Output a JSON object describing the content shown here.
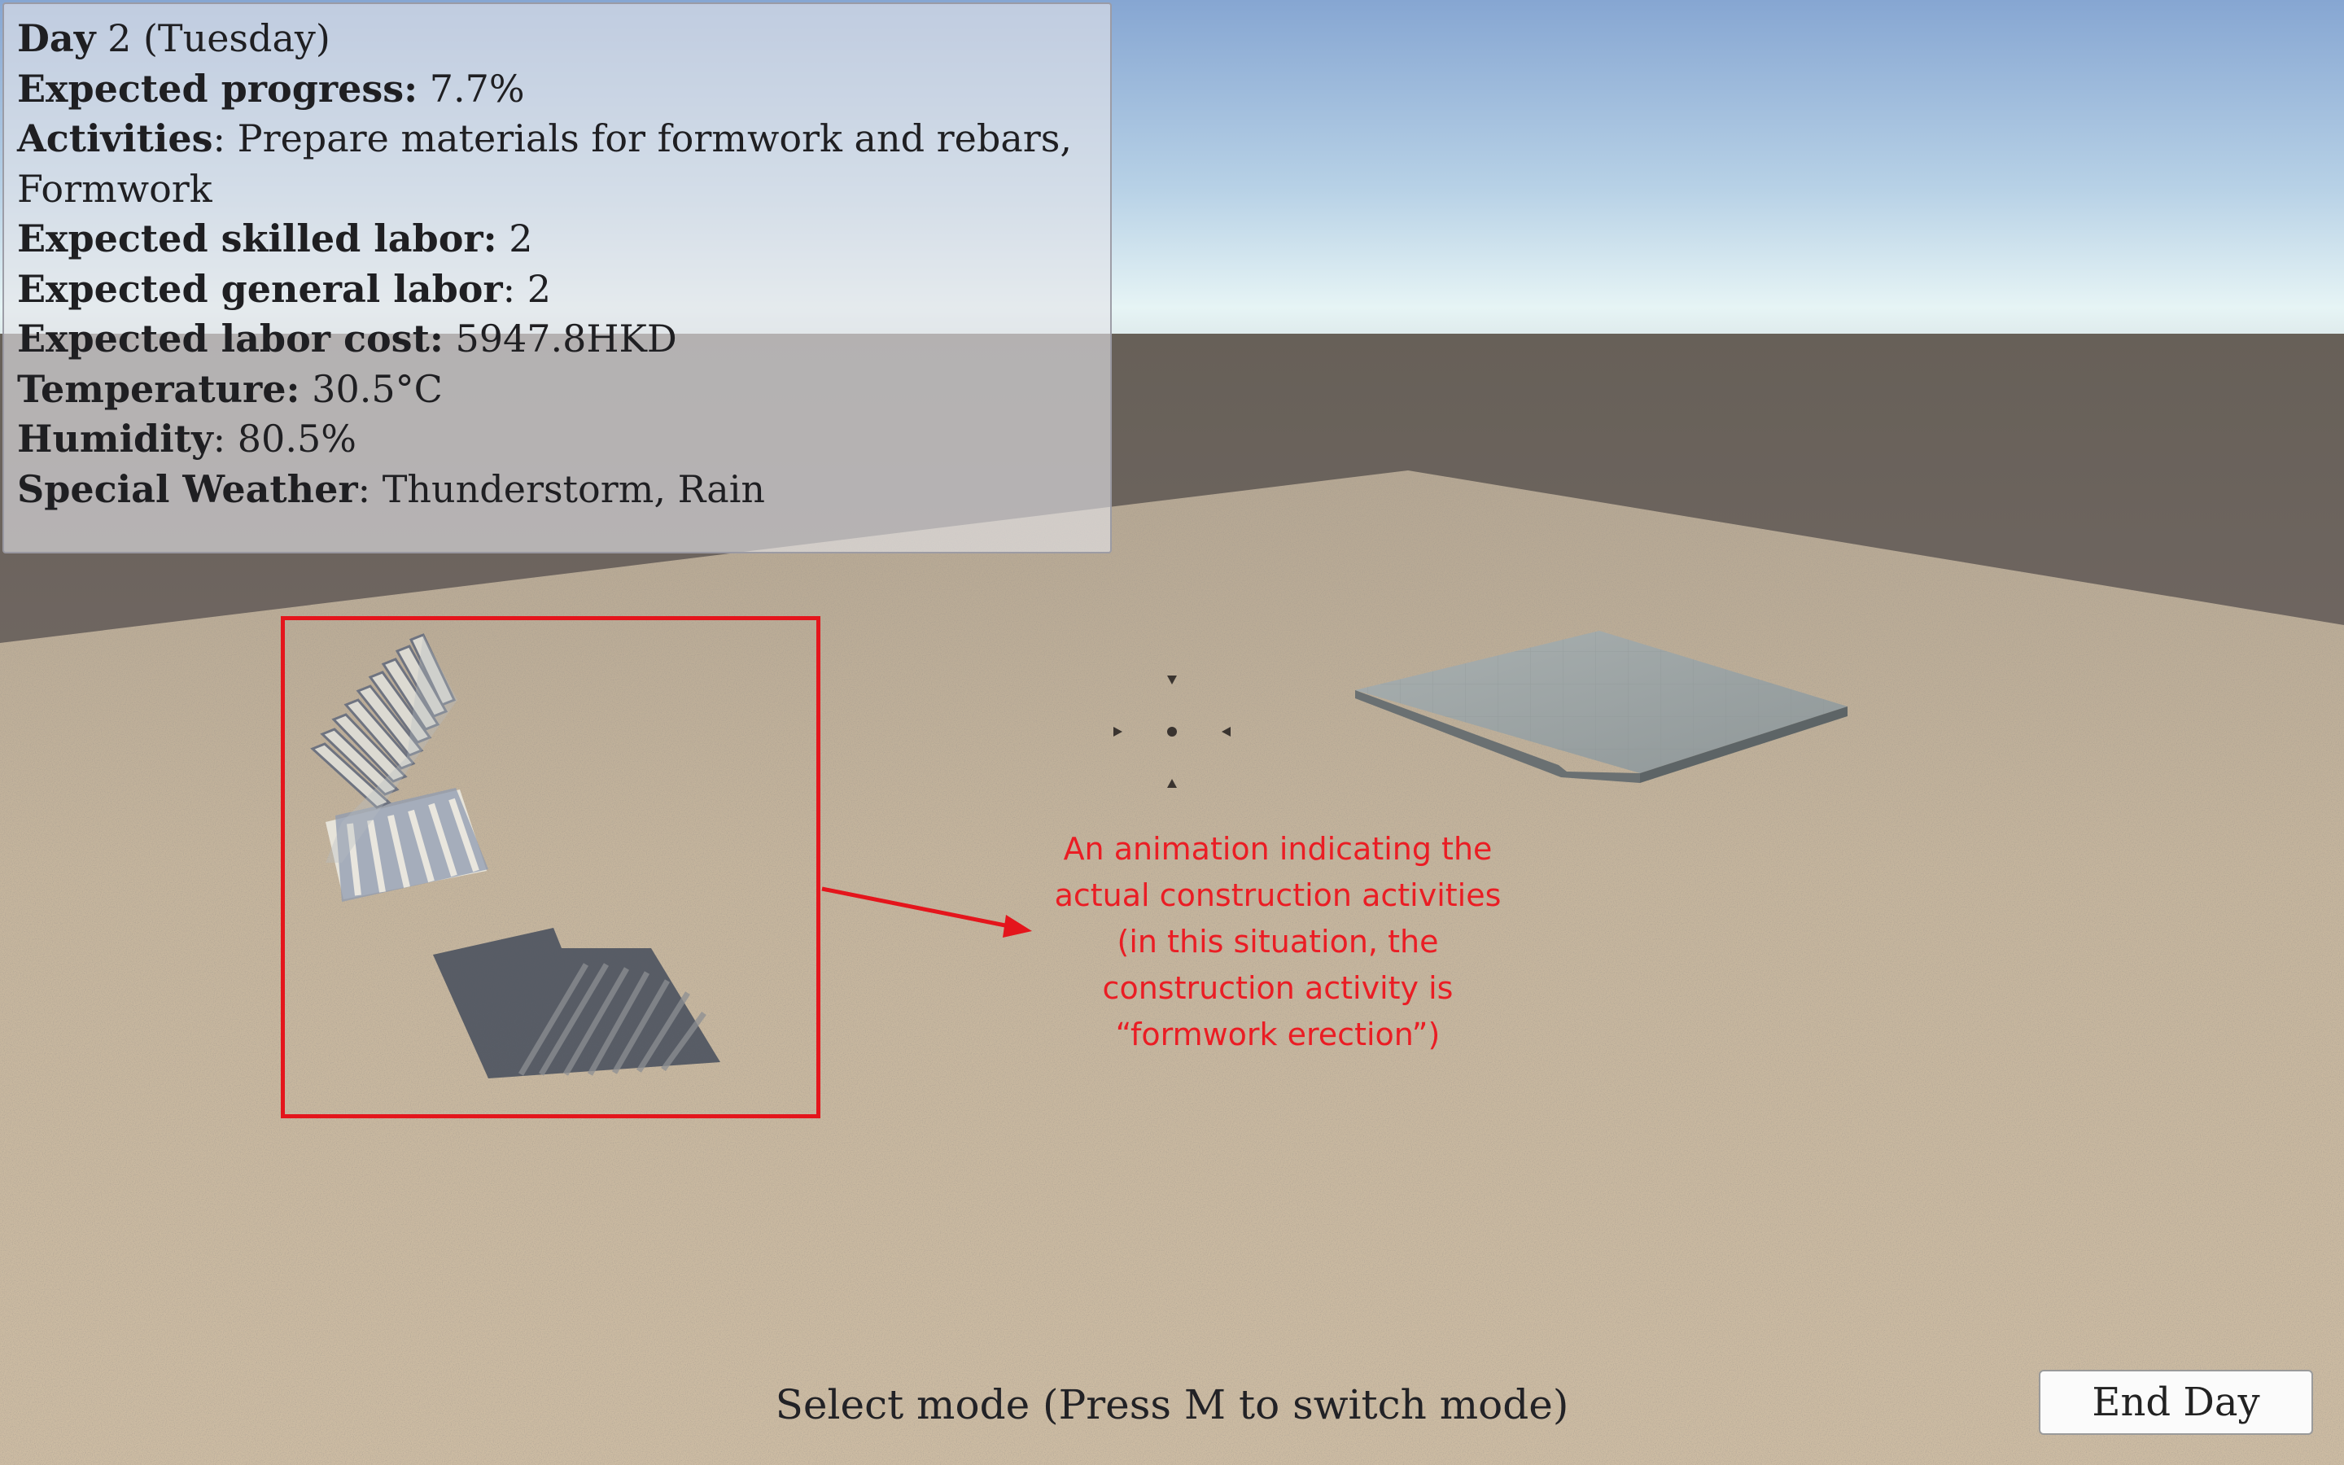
{
  "hud": {
    "day_label": "Day",
    "day_value": "2 (Tuesday)",
    "progress_label": "Expected progress:",
    "progress_value": "7.7%",
    "activities_label": "Activities",
    "activities_value": ": Prepare materials for formwork and rebars, Formwork",
    "skilled_label": "Expected skilled labor:",
    "skilled_value": "2",
    "general_label": "Expected general labor",
    "general_value": ": 2",
    "cost_label": "Expected labor cost:",
    "cost_value": "5947.8HKD",
    "temperature_label": "Temperature:",
    "temperature_value": "30.5°C",
    "humidity_label": "Humidity",
    "humidity_value": ": 80.5%",
    "weather_label": "Special Weather",
    "weather_value": ": Thunderstorm, Rain"
  },
  "annotation": {
    "lines": [
      "An animation indicating the",
      "actual construction activities",
      "(in this situation, the",
      "construction activity is",
      "“formwork erection”)"
    ],
    "color": "#e4151c"
  },
  "footer": {
    "mode_text": "Select mode (Press M to switch mode)",
    "end_day_label": "End Day"
  },
  "icons": {
    "crosshair": "crosshair-icon",
    "arrow": "red-arrow"
  },
  "colors": {
    "sky_top": "#8ba8d1",
    "sky_horizon": "#e4f2f4",
    "ground_far": "#6d6561",
    "terrain": "#c4b39b",
    "slab": "#9ea6a7"
  }
}
